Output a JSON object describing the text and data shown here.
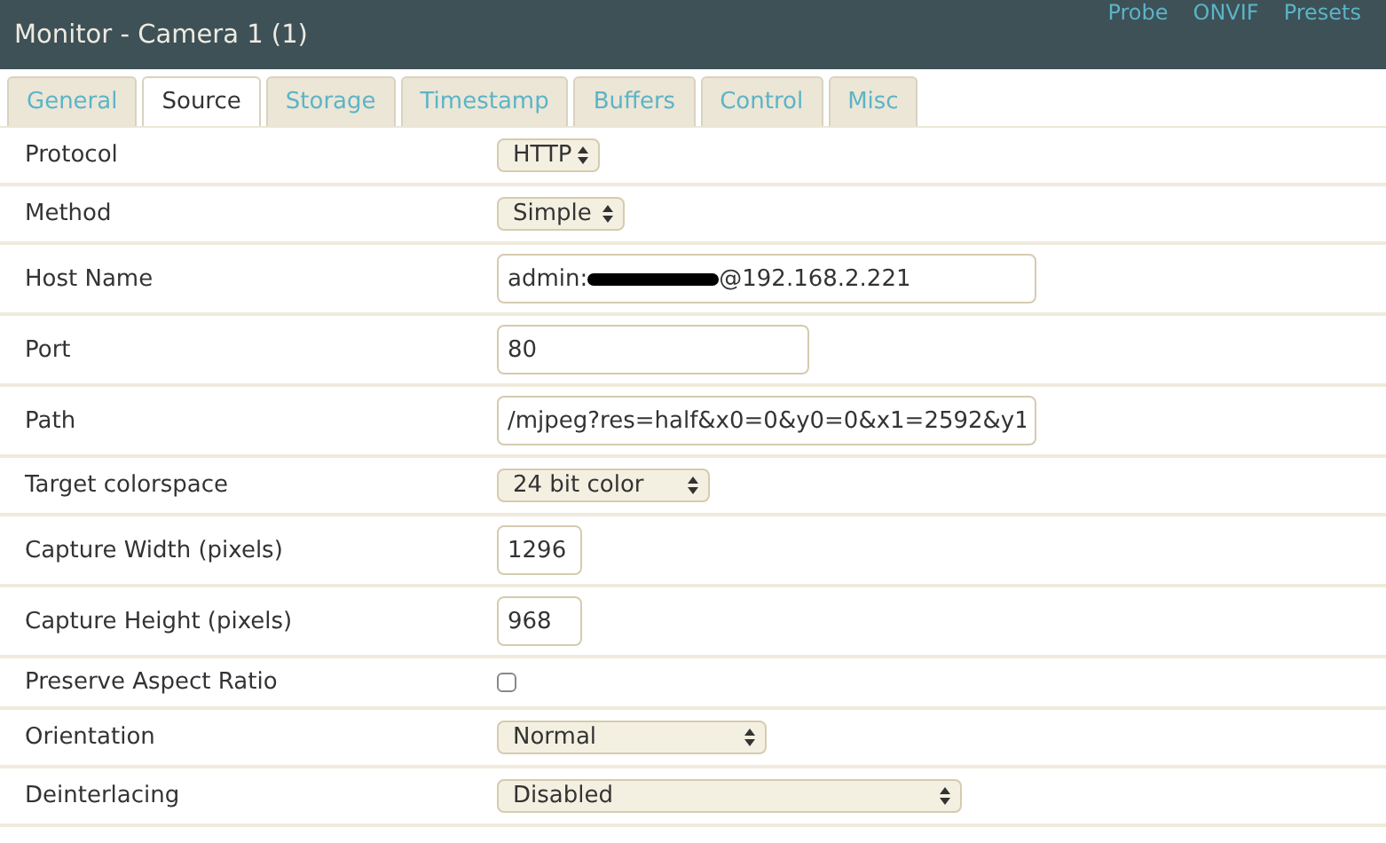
{
  "window": {
    "title": "Monitor - Camera 1 (1)"
  },
  "header_links": [
    "Probe",
    "ONVIF",
    "Presets"
  ],
  "tabs": [
    {
      "label": "General",
      "selected": false
    },
    {
      "label": "Source",
      "selected": true
    },
    {
      "label": "Storage",
      "selected": false
    },
    {
      "label": "Timestamp",
      "selected": false
    },
    {
      "label": "Buffers",
      "selected": false
    },
    {
      "label": "Control",
      "selected": false
    },
    {
      "label": "Misc",
      "selected": false
    }
  ],
  "rows": [
    {
      "label": "Protocol",
      "kind": "select",
      "value": "HTTP"
    },
    {
      "label": "Method",
      "kind": "select",
      "value": "Simple"
    },
    {
      "label": "Host Name",
      "kind": "redacted",
      "value": "admin:",
      "value_after": "@192.168.2.221"
    },
    {
      "label": "Port",
      "kind": "text",
      "value": "80"
    },
    {
      "label": "Path",
      "kind": "text",
      "value": "/mjpeg?res=half&x0=0&y0=0&x1=2592&y1"
    },
    {
      "label": "Target colorspace",
      "kind": "select",
      "value": "24 bit color"
    },
    {
      "label": "Capture Width (pixels)",
      "kind": "text",
      "value": "1296"
    },
    {
      "label": "Capture Height (pixels)",
      "kind": "text",
      "value": "968"
    },
    {
      "label": "Preserve Aspect Ratio",
      "kind": "checkbox",
      "checked": false
    },
    {
      "label": "Orientation",
      "kind": "select",
      "value": "Normal"
    },
    {
      "label": "Deinterlacing",
      "kind": "select",
      "value": "Disabled"
    }
  ]
}
